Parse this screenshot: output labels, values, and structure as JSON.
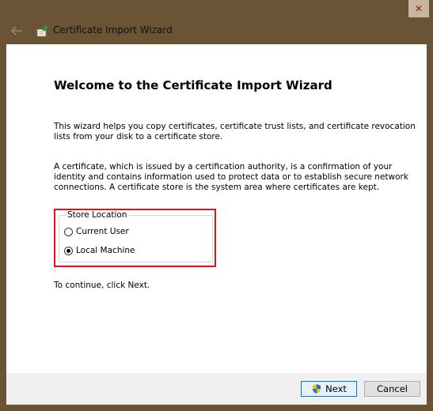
{
  "window": {
    "title": "Certificate Import Wizard",
    "close_glyph": "✕"
  },
  "icons": {
    "back": "back-arrow-icon",
    "title": "certificate-icon",
    "shield": "uac-shield-icon"
  },
  "main": {
    "heading": "Welcome to the Certificate Import Wizard",
    "intro": "This wizard helps you copy certificates, certificate trust lists, and certificate revocation lists from your disk to a certificate store.",
    "description": "A certificate, which is issued by a certification authority, is a confirmation of your identity and contains information used to protect data or to establish secure network connections. A certificate store is the system area where certificates are kept.",
    "store_location": {
      "legend": "Store Location",
      "options": [
        {
          "label": "Current User",
          "selected": false
        },
        {
          "label": "Local Machine",
          "selected": true
        }
      ]
    },
    "continue_text": "To continue, click Next."
  },
  "footer": {
    "next_label": "Next",
    "cancel_label": "Cancel"
  },
  "colors": {
    "highlight": "#e0121b",
    "frame": "#6b5335",
    "close_button": "#c8b59d"
  }
}
